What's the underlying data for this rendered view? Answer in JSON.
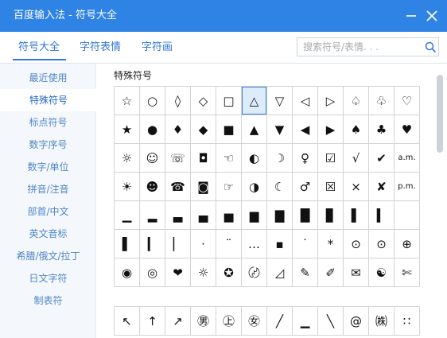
{
  "window": {
    "title": "百度输入法 - 符号大全"
  },
  "tabs": [
    {
      "label": "符号大全"
    },
    {
      "label": "字符表情"
    },
    {
      "label": "字符画"
    }
  ],
  "search": {
    "placeholder": "搜索符号/表情. . ."
  },
  "sidebar": {
    "items": [
      {
        "label": "最近使用"
      },
      {
        "label": "特殊符号"
      },
      {
        "label": "标点符号"
      },
      {
        "label": "数字序号"
      },
      {
        "label": "数字/单位"
      },
      {
        "label": "拼音/注音"
      },
      {
        "label": "部首/中文"
      },
      {
        "label": "英文音标"
      },
      {
        "label": "希腊/俄文/拉丁"
      },
      {
        "label": "日文字符"
      },
      {
        "label": "制表符"
      }
    ],
    "active_index": 1
  },
  "section": {
    "title": "特殊符号"
  },
  "symbols": [
    [
      "☆",
      "○",
      "◊",
      "◇",
      "□",
      "△",
      "▽",
      "◁",
      "▷",
      "♤",
      "♧",
      "♡"
    ],
    [
      "★",
      "●",
      "♦",
      "◆",
      "■",
      "▲",
      "▼",
      "◀",
      "▶",
      "♠",
      "♣",
      "♥"
    ],
    [
      "☼",
      "☺",
      "☏",
      "◘",
      "☜",
      "◐",
      "☽",
      "♀",
      "☑",
      "√",
      "✔",
      "a.m."
    ],
    [
      "☀",
      "☻",
      "☎",
      "◙",
      "☞",
      "◑",
      "☾",
      "♂",
      "☒",
      "×",
      "✘",
      "p.m."
    ],
    [
      "▁",
      "▂",
      "▃",
      "▄",
      "▅",
      "▆",
      "▇",
      "█",
      "▊",
      "▌",
      "▍",
      ""
    ],
    [
      "▌",
      "▎",
      "▏",
      "·",
      "¨",
      "…",
      "▪",
      "˙",
      "*",
      "⊙",
      "⊙",
      "⊕"
    ],
    [
      "◉",
      "◎",
      "❤",
      "☼",
      "✪",
      "〄",
      "◿",
      "✎",
      "✐",
      "✉",
      "☯",
      "✄"
    ]
  ],
  "symbols_row2": [
    "↖",
    "↑",
    "↗",
    "㊚",
    "㊤",
    "㊛",
    "╱",
    "▁",
    "╲",
    "@",
    "㈱",
    "∷"
  ],
  "selected_symbol": {
    "row": 0,
    "col": 5
  },
  "colors": {
    "accent": "#2f83e4",
    "tab_text": "#3377d6",
    "sidebar_text": "#4f86c6",
    "grid_line": "#d3d3d3"
  }
}
